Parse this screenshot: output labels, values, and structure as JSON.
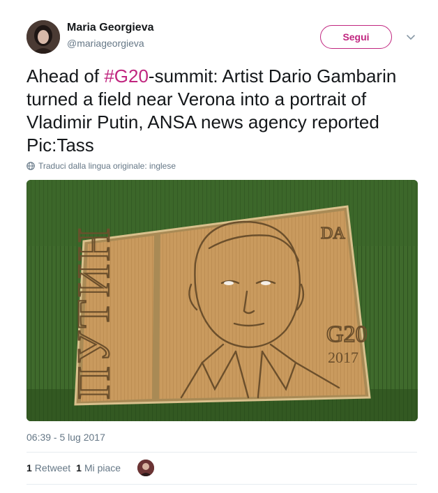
{
  "user": {
    "display_name": "Maria Georgieva",
    "handle": "@mariageorgieva"
  },
  "follow_button": {
    "label": "Segui"
  },
  "tweet": {
    "text_before": "Ahead of ",
    "hashtag": "#G20",
    "text_after": "-summit: Artist Dario Gambarin turned a field near Verona into a portrait of Vladimir Putin, ANSA news agency reported Pic:Tass"
  },
  "translate": {
    "label": "Traduci dalla lingua originale: inglese",
    "icon": "globe-icon"
  },
  "media": {
    "field_text_left": "ПУТИН",
    "field_text_event": "G20",
    "field_text_year": "2017",
    "field_text_signature": "DA"
  },
  "timestamp": "06:39 - 5 lug 2017",
  "stats": {
    "retweets_count": "1",
    "retweets_label": "Retweet",
    "likes_count": "1",
    "likes_label": "Mi piace"
  },
  "colors": {
    "accent": "#c0257f",
    "secondary_text": "#657786",
    "divider": "#e6ecf0"
  }
}
